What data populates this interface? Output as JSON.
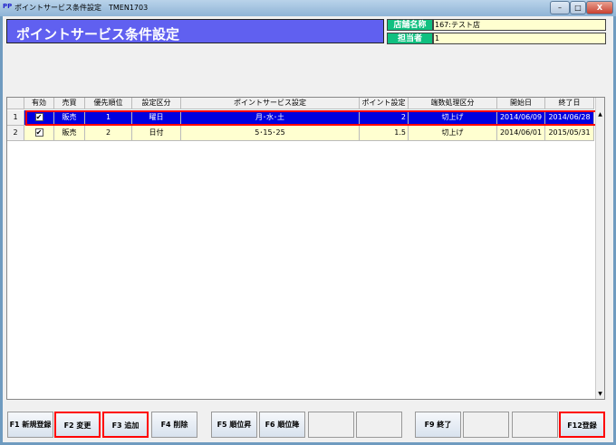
{
  "window": {
    "title": "ポイントサービス条件設定　TMEN1703",
    "minimize": "–",
    "maximize": "□",
    "close": "X"
  },
  "header": {
    "title": "ポイントサービス条件設定",
    "store_label": "店舗名称",
    "store_value": "167:テスト店",
    "staff_label": "担当者",
    "staff_value": "1"
  },
  "table": {
    "columns": [
      "有効",
      "売買",
      "優先順位",
      "設定区分",
      "ポイントサービス設定",
      "ポイント設定",
      "端数処理区分",
      "開始日",
      "終了日"
    ],
    "rows": [
      {
        "no": "1",
        "valid": "✔",
        "trade": "販売",
        "priority": "1",
        "type": "曜日",
        "setting": "月･水･土",
        "point": "2",
        "rounding": "切上げ",
        "start": "2014/06/09",
        "end": "2014/06/28"
      },
      {
        "no": "2",
        "valid": "✔",
        "trade": "販売",
        "priority": "2",
        "type": "日付",
        "setting": "5･15･25",
        "point": "1.5",
        "rounding": "切上げ",
        "start": "2014/06/01",
        "end": "2015/05/31"
      }
    ],
    "selected_row": 1
  },
  "buttons": {
    "f1": "F1 新規登録",
    "f2": "F2 変更",
    "f3": "F3 追加",
    "f4": "F4 削除",
    "f5": "F5 順位昇",
    "f6": "F6 順位降",
    "f9": "F9 終了",
    "f12": "F12登録"
  },
  "colors": {
    "header": "#6060f0",
    "label": "#10c080",
    "selected": "#0000e0",
    "row": "#ffffd0"
  }
}
